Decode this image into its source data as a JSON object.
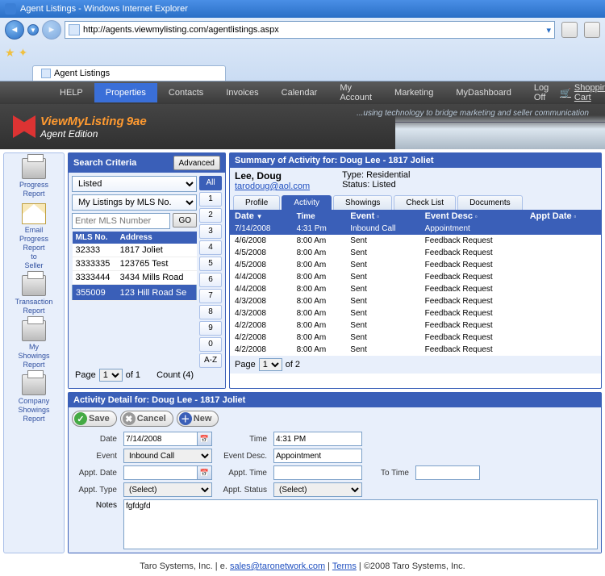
{
  "window": {
    "title": "Agent Listings - Windows Internet Explorer",
    "url": "http://agents.viewmylisting.com/agentlistings.aspx",
    "tab": "Agent Listings"
  },
  "menu": {
    "items": [
      "HELP",
      "Properties",
      "Contacts",
      "Invoices",
      "Calendar",
      "My Account",
      "Marketing",
      "MyDashboard",
      "Log Off"
    ],
    "cart": "Shopping Cart"
  },
  "brand": {
    "name": "ViewMyListing",
    "suffix": "9ae",
    "sub": "Agent Edition",
    "tagline": "...using technology to bridge marketing and seller communication"
  },
  "side": [
    {
      "icon": "printer",
      "label": "Progress Report"
    },
    {
      "icon": "mail",
      "label": "Email Progress Report to Seller"
    },
    {
      "icon": "printer",
      "label": "Transaction Report"
    },
    {
      "icon": "printer",
      "label": "My Showings Report"
    },
    {
      "icon": "printer",
      "label": "Company Showings Report"
    }
  ],
  "search": {
    "title": "Search Criteria",
    "advanced": "Advanced",
    "status": "Listed",
    "filter": "My Listings by MLS No.",
    "placeholder": "Enter MLS Number",
    "go": "GO",
    "cols": [
      "MLS No.",
      "Address"
    ],
    "rows": [
      {
        "mls": "32333",
        "addr": "1817 Joliet"
      },
      {
        "mls": "3333335",
        "addr": "123765 Test"
      },
      {
        "mls": "3333444",
        "addr": "3434 Mills Road"
      },
      {
        "mls": "355009",
        "addr": "123 Hill Road Se"
      }
    ],
    "pages": [
      "All",
      "1",
      "2",
      "3",
      "4",
      "5",
      "6",
      "7",
      "8",
      "9",
      "0",
      "A-Z"
    ],
    "pager": {
      "page": "Page",
      "sel": "1",
      "of": "of 1",
      "count": "Count (4)"
    }
  },
  "summary": {
    "title": "Summary of Activity for: Doug Lee - 1817 Joliet",
    "name": "Lee, Doug",
    "email": "tarodoug@aol.com",
    "type_lbl": "Type:",
    "type": "Residential",
    "status_lbl": "Status:",
    "status": "Listed",
    "tabs": [
      "Profile",
      "Activity",
      "Showings",
      "Check List",
      "Documents"
    ],
    "cols": [
      "Date",
      "Time",
      "Event",
      "Event Desc",
      "Appt Date"
    ],
    "rows": [
      {
        "d": "7/14/2008",
        "t": "4:31 Pm",
        "e": "Inbound Call",
        "ed": "Appointment"
      },
      {
        "d": "4/6/2008",
        "t": "8:00 Am",
        "e": "Sent",
        "ed": "Feedback Request"
      },
      {
        "d": "4/5/2008",
        "t": "8:00 Am",
        "e": "Sent",
        "ed": "Feedback Request"
      },
      {
        "d": "4/5/2008",
        "t": "8:00 Am",
        "e": "Sent",
        "ed": "Feedback Request"
      },
      {
        "d": "4/4/2008",
        "t": "8:00 Am",
        "e": "Sent",
        "ed": "Feedback Request"
      },
      {
        "d": "4/4/2008",
        "t": "8:00 Am",
        "e": "Sent",
        "ed": "Feedback Request"
      },
      {
        "d": "4/3/2008",
        "t": "8:00 Am",
        "e": "Sent",
        "ed": "Feedback Request"
      },
      {
        "d": "4/3/2008",
        "t": "8:00 Am",
        "e": "Sent",
        "ed": "Feedback Request"
      },
      {
        "d": "4/2/2008",
        "t": "8:00 Am",
        "e": "Sent",
        "ed": "Feedback Request"
      },
      {
        "d": "4/2/2008",
        "t": "8:00 Am",
        "e": "Sent",
        "ed": "Feedback Request"
      },
      {
        "d": "4/2/2008",
        "t": "8:00 Am",
        "e": "Sent",
        "ed": "Feedback Request"
      }
    ],
    "pager": {
      "page": "Page",
      "sel": "1",
      "of": "of 2"
    }
  },
  "detail": {
    "title": "Activity Detail for: Doug Lee - 1817 Joliet",
    "btns": {
      "save": "Save",
      "cancel": "Cancel",
      "new": "New"
    },
    "labels": {
      "date": "Date",
      "event": "Event",
      "appt_date": "Appt. Date",
      "appt_type": "Appt. Type",
      "time": "Time",
      "event_desc": "Event Desc.",
      "appt_time": "Appt. Time",
      "appt_status": "Appt. Status",
      "to_time": "To Time",
      "notes": "Notes"
    },
    "values": {
      "date": "7/14/2008",
      "event": "Inbound Call",
      "appt_date": "",
      "appt_type": "(Select)",
      "time": "4:31 PM",
      "event_desc": "Appointment",
      "appt_time": "",
      "appt_status": "(Select)",
      "to_time": "",
      "notes": "fgfdgfd"
    }
  },
  "footer": {
    "company": "Taro Systems, Inc.",
    "sep": "   |  e. ",
    "email": "sales@taronetwork.com",
    "sep2": "  |  ",
    "terms": "Terms",
    "sep3": "  | ©2008 Taro Systems, Inc."
  }
}
